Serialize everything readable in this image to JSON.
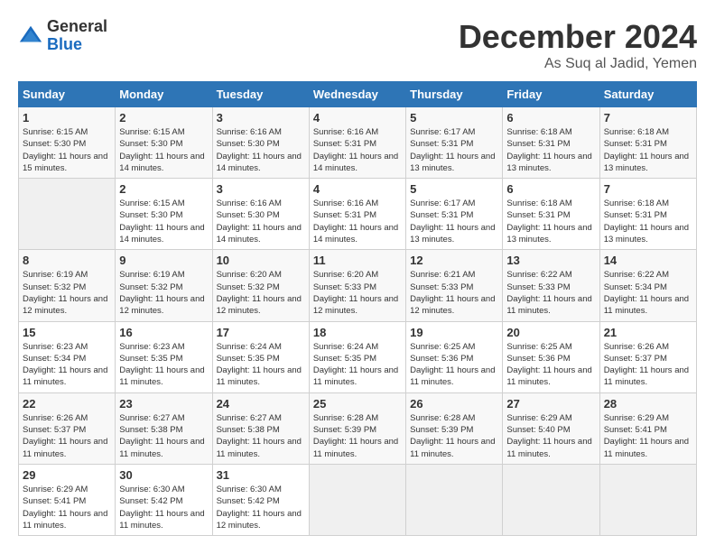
{
  "header": {
    "logo": {
      "general": "General",
      "blue": "Blue"
    },
    "title": "December 2024",
    "location": "As Suq al Jadid, Yemen"
  },
  "calendar": {
    "days_of_week": [
      "Sunday",
      "Monday",
      "Tuesday",
      "Wednesday",
      "Thursday",
      "Friday",
      "Saturday"
    ],
    "weeks": [
      [
        {
          "day": "",
          "empty": true
        },
        {
          "day": "2",
          "sunrise": "6:15 AM",
          "sunset": "5:30 PM",
          "daylight": "11 hours and 14 minutes."
        },
        {
          "day": "3",
          "sunrise": "6:16 AM",
          "sunset": "5:30 PM",
          "daylight": "11 hours and 14 minutes."
        },
        {
          "day": "4",
          "sunrise": "6:16 AM",
          "sunset": "5:31 PM",
          "daylight": "11 hours and 14 minutes."
        },
        {
          "day": "5",
          "sunrise": "6:17 AM",
          "sunset": "5:31 PM",
          "daylight": "11 hours and 13 minutes."
        },
        {
          "day": "6",
          "sunrise": "6:18 AM",
          "sunset": "5:31 PM",
          "daylight": "11 hours and 13 minutes."
        },
        {
          "day": "7",
          "sunrise": "6:18 AM",
          "sunset": "5:31 PM",
          "daylight": "11 hours and 13 minutes."
        }
      ],
      [
        {
          "day": "8",
          "sunrise": "6:19 AM",
          "sunset": "5:32 PM",
          "daylight": "11 hours and 12 minutes."
        },
        {
          "day": "9",
          "sunrise": "6:19 AM",
          "sunset": "5:32 PM",
          "daylight": "11 hours and 12 minutes."
        },
        {
          "day": "10",
          "sunrise": "6:20 AM",
          "sunset": "5:32 PM",
          "daylight": "11 hours and 12 minutes."
        },
        {
          "day": "11",
          "sunrise": "6:20 AM",
          "sunset": "5:33 PM",
          "daylight": "11 hours and 12 minutes."
        },
        {
          "day": "12",
          "sunrise": "6:21 AM",
          "sunset": "5:33 PM",
          "daylight": "11 hours and 12 minutes."
        },
        {
          "day": "13",
          "sunrise": "6:22 AM",
          "sunset": "5:33 PM",
          "daylight": "11 hours and 11 minutes."
        },
        {
          "day": "14",
          "sunrise": "6:22 AM",
          "sunset": "5:34 PM",
          "daylight": "11 hours and 11 minutes."
        }
      ],
      [
        {
          "day": "15",
          "sunrise": "6:23 AM",
          "sunset": "5:34 PM",
          "daylight": "11 hours and 11 minutes."
        },
        {
          "day": "16",
          "sunrise": "6:23 AM",
          "sunset": "5:35 PM",
          "daylight": "11 hours and 11 minutes."
        },
        {
          "day": "17",
          "sunrise": "6:24 AM",
          "sunset": "5:35 PM",
          "daylight": "11 hours and 11 minutes."
        },
        {
          "day": "18",
          "sunrise": "6:24 AM",
          "sunset": "5:35 PM",
          "daylight": "11 hours and 11 minutes."
        },
        {
          "day": "19",
          "sunrise": "6:25 AM",
          "sunset": "5:36 PM",
          "daylight": "11 hours and 11 minutes."
        },
        {
          "day": "20",
          "sunrise": "6:25 AM",
          "sunset": "5:36 PM",
          "daylight": "11 hours and 11 minutes."
        },
        {
          "day": "21",
          "sunrise": "6:26 AM",
          "sunset": "5:37 PM",
          "daylight": "11 hours and 11 minutes."
        }
      ],
      [
        {
          "day": "22",
          "sunrise": "6:26 AM",
          "sunset": "5:37 PM",
          "daylight": "11 hours and 11 minutes."
        },
        {
          "day": "23",
          "sunrise": "6:27 AM",
          "sunset": "5:38 PM",
          "daylight": "11 hours and 11 minutes."
        },
        {
          "day": "24",
          "sunrise": "6:27 AM",
          "sunset": "5:38 PM",
          "daylight": "11 hours and 11 minutes."
        },
        {
          "day": "25",
          "sunrise": "6:28 AM",
          "sunset": "5:39 PM",
          "daylight": "11 hours and 11 minutes."
        },
        {
          "day": "26",
          "sunrise": "6:28 AM",
          "sunset": "5:39 PM",
          "daylight": "11 hours and 11 minutes."
        },
        {
          "day": "27",
          "sunrise": "6:29 AM",
          "sunset": "5:40 PM",
          "daylight": "11 hours and 11 minutes."
        },
        {
          "day": "28",
          "sunrise": "6:29 AM",
          "sunset": "5:41 PM",
          "daylight": "11 hours and 11 minutes."
        }
      ],
      [
        {
          "day": "29",
          "sunrise": "6:29 AM",
          "sunset": "5:41 PM",
          "daylight": "11 hours and 11 minutes."
        },
        {
          "day": "30",
          "sunrise": "6:30 AM",
          "sunset": "5:42 PM",
          "daylight": "11 hours and 11 minutes."
        },
        {
          "day": "31",
          "sunrise": "6:30 AM",
          "sunset": "5:42 PM",
          "daylight": "11 hours and 12 minutes."
        },
        {
          "day": "",
          "empty": true
        },
        {
          "day": "",
          "empty": true
        },
        {
          "day": "",
          "empty": true
        },
        {
          "day": "",
          "empty": true
        }
      ]
    ],
    "first_week": [
      {
        "day": "1",
        "sunrise": "6:15 AM",
        "sunset": "5:30 PM",
        "daylight": "11 hours and 15 minutes."
      }
    ]
  }
}
